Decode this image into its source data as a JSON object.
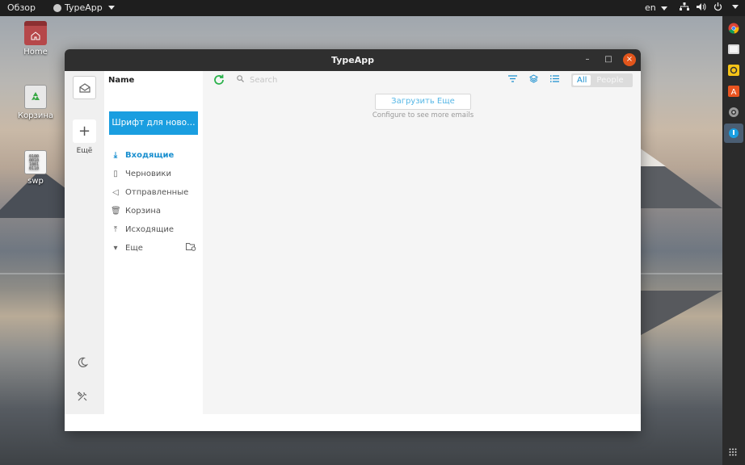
{
  "topbar": {
    "overview": "Обзор",
    "app_menu": "TypeApp",
    "language": "en"
  },
  "desktop": {
    "icons": [
      {
        "label": "Home"
      },
      {
        "label": "Корзина"
      },
      {
        "label": "swp"
      }
    ]
  },
  "window": {
    "title": "TypeApp",
    "minimize": "–",
    "maximize": "□",
    "close": "×"
  },
  "rail": {
    "more_label": "Ещё"
  },
  "folders": {
    "header": "Name",
    "compose_label": "Шрифт для ново…",
    "items": [
      {
        "label": "Входящие",
        "icon": "download-icon",
        "active": true
      },
      {
        "label": "Черновики",
        "icon": "draft-icon",
        "active": false
      },
      {
        "label": "Отправленные",
        "icon": "sent-icon",
        "active": false
      },
      {
        "label": "Корзина",
        "icon": "trash-icon",
        "active": false
      },
      {
        "label": "Исходящие",
        "icon": "outbox-icon",
        "active": false
      },
      {
        "label": "Еще",
        "icon": "chevron-down-icon",
        "active": false
      }
    ]
  },
  "main": {
    "search_placeholder": "Search",
    "filter_all": "All",
    "filter_people": "People",
    "load_more": "Загрузить Еще",
    "load_hint": "Configure to see more emails"
  },
  "colors": {
    "accent": "#1a9ee0",
    "refresh": "#2bb24c",
    "close": "#e2551b"
  }
}
